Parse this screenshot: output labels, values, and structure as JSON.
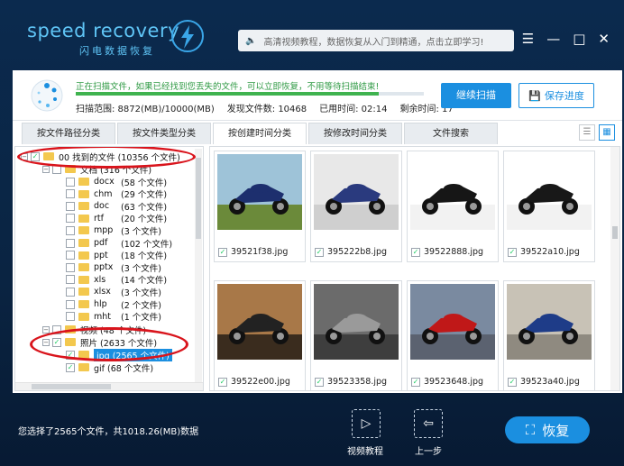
{
  "app": {
    "logo": "speed recovery",
    "logo_sub": "闪电数据恢复"
  },
  "search": {
    "text": "高清视频教程，数据恢复从入门到精通，点击立即学习!"
  },
  "window": {
    "menu": "☰",
    "minimize": "—",
    "maximize": "□",
    "close": "✕"
  },
  "scan": {
    "message": "正在扫描文件，如果已经找到您丢失的文件，可以立即恢复，不用等待扫描结束!",
    "progress": 0.87,
    "range": "扫描范围: 8872(MB)/10000(MB)",
    "found": "发现文件数: 10468",
    "elapsed": "已用时间: 02:14",
    "remaining": "剩余时间: 17",
    "continue_label": "继续扫描",
    "save_label": "保存进度"
  },
  "tabs": [
    "按文件路径分类",
    "按文件类型分类",
    "按创建时间分类",
    "按修改时间分类",
    "文件搜索"
  ],
  "active_tab": 2,
  "tree": {
    "root": "00 找到的文件 (10356 个文件)",
    "docs": "文档 (316 个文件)",
    "doc_items": [
      {
        "name": "docx",
        "count": "(58 个文件)"
      },
      {
        "name": "chm",
        "count": "(29 个文件)"
      },
      {
        "name": "doc",
        "count": "(63 个文件)"
      },
      {
        "name": "rtf",
        "count": "(20 个文件)"
      },
      {
        "name": "mpp",
        "count": "(3 个文件)"
      },
      {
        "name": "pdf",
        "count": "(102 个文件)"
      },
      {
        "name": "ppt",
        "count": "(18 个文件)"
      },
      {
        "name": "pptx",
        "count": "(3 个文件)"
      },
      {
        "name": "xls",
        "count": "(14 个文件)"
      },
      {
        "name": "xlsx",
        "count": "(3 个文件)"
      },
      {
        "name": "hlp",
        "count": "(2 个文件)"
      },
      {
        "name": "mht",
        "count": "(1 个文件)"
      }
    ],
    "video": "视频 (48 个文件)",
    "photos": "照片 (2633 个文件)",
    "jpg": "jpg (2565 个文件)",
    "gif": "gif (68 个文件)"
  },
  "files": [
    {
      "name": "39521f38.jpg",
      "sky": "#9ec3d8",
      "ground": "#6b8a3a",
      "bike": "#1d2f6e"
    },
    {
      "name": "395222b8.jpg",
      "sky": "#e8e8e8",
      "ground": "#cfcfcf",
      "bike": "#2a3a7e"
    },
    {
      "name": "39522888.jpg",
      "sky": "#ffffff",
      "ground": "#f2f2f2",
      "bike": "#161616"
    },
    {
      "name": "39522a10.jpg",
      "sky": "#ffffff",
      "ground": "#f2f2f2",
      "bike": "#181818"
    },
    {
      "name": "39522e00.jpg",
      "sky": "#a87848",
      "ground": "#3a2c1e",
      "bike": "#222222"
    },
    {
      "name": "39523358.jpg",
      "sky": "#6b6b6b",
      "ground": "#3e3e3e",
      "bike": "#9a9a9a"
    },
    {
      "name": "39523648.jpg",
      "sky": "#7a8aa0",
      "ground": "#5b6270",
      "bike": "#c01818"
    },
    {
      "name": "39523a40.jpg",
      "sky": "#c8c2b6",
      "ground": "#8f8a80",
      "bike": "#1e3c88"
    }
  ],
  "footer": {
    "summary": "您选择了2565个文件，共1018.26(MB)数据",
    "video_label": "视频教程",
    "back_label": "上一步",
    "restore_label": "恢复"
  },
  "colors": {
    "accent": "#1b8fe0",
    "progress": "#3fb34f",
    "annotation": "#d9141c"
  }
}
